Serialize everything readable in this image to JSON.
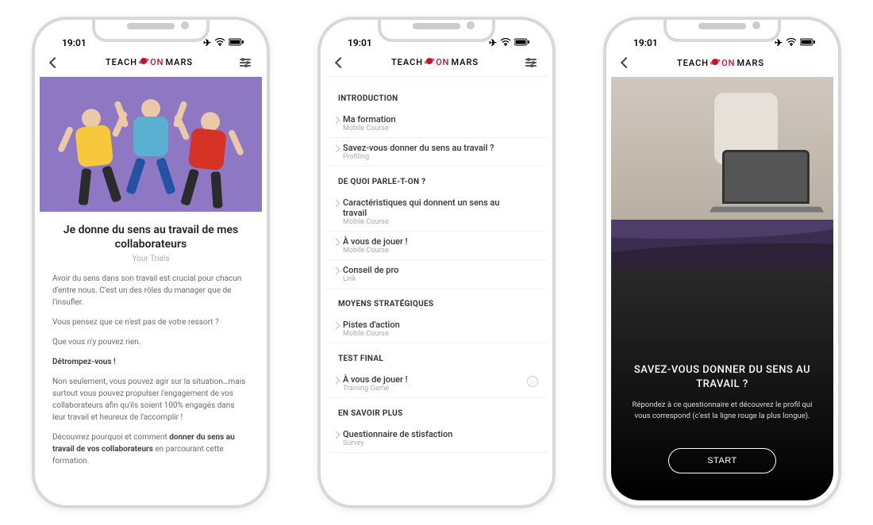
{
  "status": {
    "time": "19:01"
  },
  "brand": {
    "pre": "TEACH ",
    "mid": "ON",
    "post": " MARS",
    "icon_name": "planet-icon"
  },
  "phone1": {
    "title": "Je donne du sens au travail de mes collaborateurs",
    "subtitle": "Your Trials",
    "p1": "Avoir du sens dans son travail est crucial pour chacun d'entre nous. C'est un des rôles du manager que de l'insufler.",
    "p2": "Vous pensez que ce n'est pas de votre ressort ?",
    "p3": "Que vous n'y pouvez rien.",
    "p4": "Détrompez-vous !",
    "p5": "Non seulement, vous pouvez agir sur la situation…mais surtout vous pouvez propulser l'engagement de vos collaborateurs afin qu'ils soient 100% engagés dans leur travail et heureux de l'accomplir !",
    "p6a": "Découvrez pourquoi et comment ",
    "p6b": "donner du sens au travail de vos collaborateurs",
    "p6c": " en parcourant cette formation."
  },
  "phone2": {
    "sections": [
      {
        "title": "INTRODUCTION",
        "items": [
          {
            "title": "Ma formation",
            "sub": "Mobile Course"
          },
          {
            "title": "Savez-vous donner du sens au travail ?",
            "sub": "Profiling"
          }
        ]
      },
      {
        "title": "DE QUOI PARLE-T-ON ?",
        "items": [
          {
            "title": "Caractéristiques qui donnent un sens au travail",
            "sub": "Mobile Course"
          },
          {
            "title": "À vous de jouer !",
            "sub": "Mobile Course"
          },
          {
            "title": "Conseil de pro",
            "sub": "Link"
          }
        ]
      },
      {
        "title": "MOYENS STRATÉGIQUES",
        "items": [
          {
            "title": "Pistes d'action",
            "sub": "Mobile Course"
          }
        ]
      },
      {
        "title": "TEST FINAL",
        "items": [
          {
            "title": "À vous de jouer !",
            "sub": "Training Game",
            "star": true
          }
        ]
      },
      {
        "title": "EN SAVOIR PLUS",
        "items": [
          {
            "title": "Questionnaire de stisfaction",
            "sub": "Survey"
          }
        ]
      }
    ]
  },
  "phone3": {
    "question_title": "SAVEZ-VOUS DONNER DU SENS AU TRAVAIL ?",
    "question_desc": "Répondez à ce questionnaire et découvrez le profil qui vous correspond (c'est la ligne rouge la plus longue).",
    "start_label": "START"
  }
}
